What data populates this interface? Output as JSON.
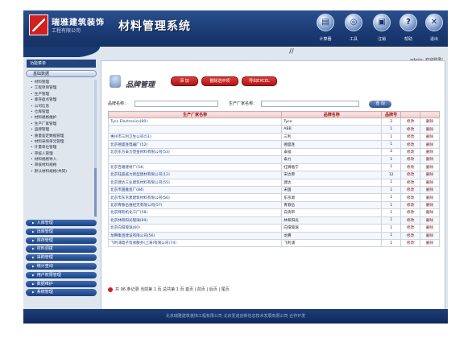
{
  "header": {
    "company_name": "瑞雅建筑装饰",
    "company_sub": "工程有限公司",
    "system_title": "材料管理系统",
    "tools": [
      {
        "label": "计算器",
        "icon": "calculator-icon",
        "glyph": "▤"
      },
      {
        "label": "工具",
        "icon": "tools-icon",
        "glyph": "◎"
      },
      {
        "label": "注销",
        "icon": "lock-icon",
        "glyph": "▣"
      },
      {
        "label": "帮助",
        "icon": "help-icon",
        "glyph": "?"
      },
      {
        "label": "退出",
        "icon": "exit-icon",
        "glyph": "✕"
      }
    ],
    "user_greeting": "admin: 欢迎登录!"
  },
  "sidebar": {
    "title": "功能菜单",
    "active_menu": "基础数据",
    "subitems": [
      "材料管理",
      "工程项目管理",
      "生产管理",
      "库存盘点管理",
      "公司信息",
      "仓库管理",
      "材料规格维护",
      "生产厂家管理",
      "品牌管理",
      "质量鉴定数据管理",
      "材料采购单元管理",
      "计量单位管理",
      "审核人管理",
      "材料规格导入",
      "审核材料规格",
      "默认材料规格(共同)"
    ],
    "menus": [
      "入库管理",
      "出库管理",
      "库存管理",
      "材料调拨",
      "采购管理",
      "统计查询",
      "用户权限管理",
      "数据维护",
      "系统管理"
    ]
  },
  "main": {
    "page_title": "品牌管理",
    "buttons": [
      "添 加",
      "删除选中项",
      "导出EXCEL"
    ],
    "search": {
      "brand_label": "品牌名称：",
      "brand_value": "",
      "maker_label": "生产厂家名称：",
      "maker_value": "",
      "button": "查 询"
    },
    "table": {
      "headers": [
        "生产厂家名称",
        "品牌名称",
        "品牌号",
        "",
        ""
      ],
      "rows": [
        {
          "maker": "Tyco Electronics(80)",
          "brand": "Tyco",
          "no": "2",
          "edit": "修改",
          "del": "删除"
        },
        {
          "maker": "",
          "brand": "ABB",
          "no": "1",
          "edit": "修改",
          "del": "删除"
        },
        {
          "maker": "惠州市三利卫生公司(51)",
          "brand": "三利",
          "no": "1",
          "edit": "修改",
          "del": "删除"
        },
        {
          "maker": "北京德盛连电器厂(52)",
          "brand": "德盛连",
          "no": "1",
          "edit": "修改",
          "del": "删除"
        },
        {
          "maker": "北京东方泰力塑金材料有限公司(53)",
          "brand": "泰福",
          "no": "2",
          "edit": "修改",
          "del": "删除"
        },
        {
          "maker": "",
          "brand": "泰力",
          "no": "1",
          "edit": "修改",
          "del": "删除"
        },
        {
          "maker": "北京百顺建材厂(54)",
          "brand": "红狮瓶宁",
          "no": "1",
          "edit": "修改",
          "del": "删除"
        },
        {
          "maker": "北京钰森威力新型建材有限公司(12)",
          "brand": "宋达原",
          "no": "12",
          "edit": "修改",
          "del": "删除"
        },
        {
          "maker": "北京建达三业建筑材料有限公司(55)",
          "brand": "建达",
          "no": "1",
          "edit": "修改",
          "del": "删除"
        },
        {
          "maker": "北京市国雅瓷厂(84)",
          "brand": "宋国",
          "no": "1",
          "edit": "修改",
          "del": "删除"
        },
        {
          "maker": "北京市东京建建筑材料有限公司(56)",
          "brand": "东京源",
          "no": "1",
          "edit": "修改",
          "del": "删除"
        },
        {
          "maker": "北京青春岳维控无有限公司(57)",
          "brand": "青春岳",
          "no": "1",
          "edit": "修改",
          "del": "删除"
        },
        {
          "maker": "北京拜有机化工厂(58)",
          "brand": "白资带",
          "no": "1",
          "edit": "修改",
          "del": "删除"
        },
        {
          "maker": "北京林和阳光玻璃(89)",
          "brand": "林和阳光",
          "no": "1",
          "edit": "修改",
          "del": "删除"
        },
        {
          "maker": "北京向阳玻璃(60)",
          "brand": "向阳玻璃",
          "no": "1",
          "edit": "修改",
          "del": "删除"
        },
        {
          "maker": "龙腾集团建设有限公司(56)",
          "brand": "龙腾",
          "no": "1",
          "edit": "修改",
          "del": "删除"
        },
        {
          "maker": "飞利浦电子贸易服务(上海)有限公司(74)",
          "brand": "飞利浦",
          "no": "1",
          "edit": "修改",
          "del": "删除"
        }
      ]
    },
    "pager": "共 96 条记录  当前第 1 页  总共第 1 页    首页 | 前页 | 后页 | 尾页"
  },
  "footer": {
    "text": "北京瑞雅建筑装饰工程有限公司    北京爱迪创新信息技术发展有限公司    合作开发"
  }
}
